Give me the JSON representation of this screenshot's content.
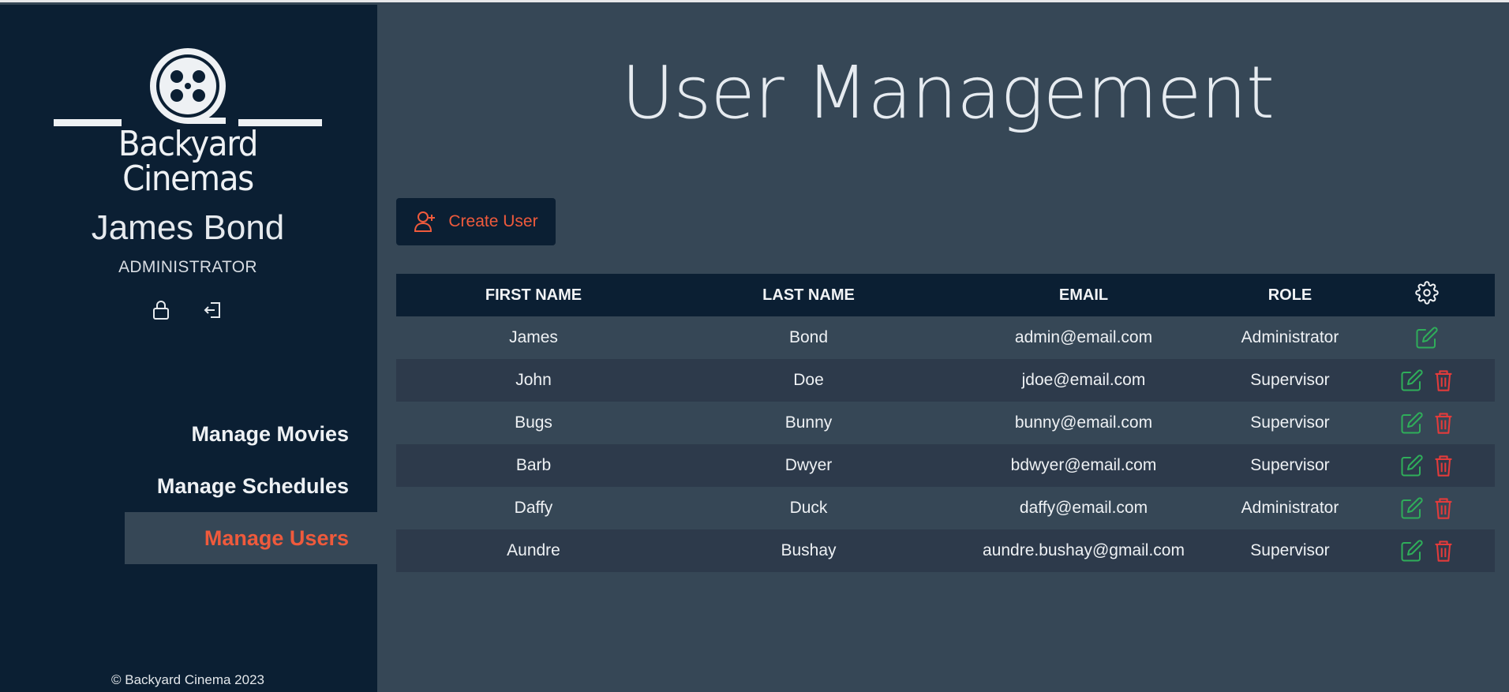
{
  "brand": {
    "name": "Backyard Cinemas"
  },
  "user": {
    "name": "James Bond",
    "role": "ADMINISTRATOR"
  },
  "nav": {
    "items": [
      {
        "label": "Manage Movies",
        "active": false
      },
      {
        "label": "Manage Schedules",
        "active": false
      },
      {
        "label": "Manage Users",
        "active": true
      }
    ]
  },
  "footer": {
    "text": "© Backyard Cinema 2023"
  },
  "page": {
    "title": "User Management"
  },
  "toolbar": {
    "create_label": "Create User"
  },
  "table": {
    "headers": [
      "FIRST NAME",
      "LAST NAME",
      "EMAIL",
      "ROLE"
    ],
    "settings_icon": "gear-icon",
    "rows": [
      {
        "first": "James",
        "last": "Bond",
        "email": "admin@email.com",
        "role": "Administrator",
        "can_delete": false
      },
      {
        "first": "John",
        "last": "Doe",
        "email": "jdoe@email.com",
        "role": "Supervisor",
        "can_delete": true
      },
      {
        "first": "Bugs",
        "last": "Bunny",
        "email": "bunny@email.com",
        "role": "Supervisor",
        "can_delete": true
      },
      {
        "first": "Barb",
        "last": "Dwyer",
        "email": "bdwyer@email.com",
        "role": "Supervisor",
        "can_delete": true
      },
      {
        "first": "Daffy",
        "last": "Duck",
        "email": "daffy@email.com",
        "role": "Administrator",
        "can_delete": true
      },
      {
        "first": "Aundre",
        "last": "Bushay",
        "email": "aundre.bushay@gmail.com",
        "role": "Supervisor",
        "can_delete": true
      }
    ]
  },
  "colors": {
    "sidebar_bg": "#0b1f33",
    "main_bg": "#364756",
    "accent": "#ef5a3c",
    "edit_icon": "#2fae5a",
    "delete_icon": "#e23b3b"
  }
}
